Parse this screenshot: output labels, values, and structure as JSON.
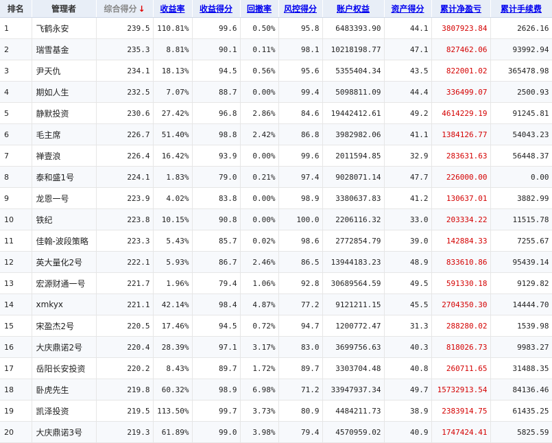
{
  "headers": {
    "rank": "排名",
    "manager": "管理者",
    "total_score": "综合得分",
    "sort_arrow": "↓",
    "return_rate": "收益率",
    "return_score": "收益得分",
    "drawdown": "回撤率",
    "risk_score": "风控得分",
    "equity": "账户权益",
    "asset_score": "资产得分",
    "cum_pnl": "累计净盈亏",
    "cum_fee": "累计手续费"
  },
  "rows": [
    {
      "rank": "1",
      "manager": "飞鹤永安",
      "total": "239.5",
      "ret": "110.81%",
      "retScore": "99.6",
      "dd": "0.50%",
      "risk": "95.8",
      "equity": "6483393.90",
      "asset": "44.1",
      "pnl": "3807923.84",
      "fee": "2626.16"
    },
    {
      "rank": "2",
      "manager": "瑞雪基金",
      "total": "235.3",
      "ret": "8.81%",
      "retScore": "90.1",
      "dd": "0.11%",
      "risk": "98.1",
      "equity": "10218198.77",
      "asset": "47.1",
      "pnl": "827462.06",
      "fee": "93992.94"
    },
    {
      "rank": "3",
      "manager": "尹天仇",
      "total": "234.1",
      "ret": "18.13%",
      "retScore": "94.5",
      "dd": "0.56%",
      "risk": "95.6",
      "equity": "5355404.34",
      "asset": "43.5",
      "pnl": "822001.02",
      "fee": "365478.98"
    },
    {
      "rank": "4",
      "manager": "期如人生",
      "total": "232.5",
      "ret": "7.07%",
      "retScore": "88.7",
      "dd": "0.00%",
      "risk": "99.4",
      "equity": "5098811.09",
      "asset": "44.4",
      "pnl": "336499.07",
      "fee": "2500.93"
    },
    {
      "rank": "5",
      "manager": "静默投资",
      "total": "230.6",
      "ret": "27.42%",
      "retScore": "96.8",
      "dd": "2.86%",
      "risk": "84.6",
      "equity": "19442412.61",
      "asset": "49.2",
      "pnl": "4614229.19",
      "fee": "91245.81"
    },
    {
      "rank": "6",
      "manager": "毛主席",
      "total": "226.7",
      "ret": "51.40%",
      "retScore": "98.8",
      "dd": "2.42%",
      "risk": "86.8",
      "equity": "3982982.06",
      "asset": "41.1",
      "pnl": "1384126.77",
      "fee": "54043.23"
    },
    {
      "rank": "7",
      "manager": "禅壹浪",
      "total": "226.4",
      "ret": "16.42%",
      "retScore": "93.9",
      "dd": "0.00%",
      "risk": "99.6",
      "equity": "2011594.85",
      "asset": "32.9",
      "pnl": "283631.63",
      "fee": "56448.37"
    },
    {
      "rank": "8",
      "manager": "泰和盛1号",
      "total": "224.1",
      "ret": "1.83%",
      "retScore": "79.0",
      "dd": "0.21%",
      "risk": "97.4",
      "equity": "9028071.14",
      "asset": "47.7",
      "pnl": "226000.00",
      "fee": "0.00"
    },
    {
      "rank": "9",
      "manager": "龙恩一号",
      "total": "223.9",
      "ret": "4.02%",
      "retScore": "83.8",
      "dd": "0.00%",
      "risk": "98.9",
      "equity": "3380637.83",
      "asset": "41.2",
      "pnl": "130637.01",
      "fee": "3882.99"
    },
    {
      "rank": "10",
      "manager": "铁纪",
      "total": "223.8",
      "ret": "10.15%",
      "retScore": "90.8",
      "dd": "0.00%",
      "risk": "100.0",
      "equity": "2206116.32",
      "asset": "33.0",
      "pnl": "203334.22",
      "fee": "11515.78"
    },
    {
      "rank": "11",
      "manager": "佳翰-波段策略",
      "total": "223.3",
      "ret": "5.43%",
      "retScore": "85.7",
      "dd": "0.02%",
      "risk": "98.6",
      "equity": "2772854.79",
      "asset": "39.0",
      "pnl": "142884.33",
      "fee": "7255.67"
    },
    {
      "rank": "12",
      "manager": "英大量化2号",
      "total": "222.1",
      "ret": "5.93%",
      "retScore": "86.7",
      "dd": "2.46%",
      "risk": "86.5",
      "equity": "13944183.23",
      "asset": "48.9",
      "pnl": "833610.86",
      "fee": "95439.14"
    },
    {
      "rank": "13",
      "manager": "宏源财通一号",
      "total": "221.7",
      "ret": "1.96%",
      "retScore": "79.4",
      "dd": "1.06%",
      "risk": "92.8",
      "equity": "30689564.59",
      "asset": "49.5",
      "pnl": "591330.18",
      "fee": "9129.82"
    },
    {
      "rank": "14",
      "manager": "xmkyx",
      "total": "221.1",
      "ret": "42.14%",
      "retScore": "98.4",
      "dd": "4.87%",
      "risk": "77.2",
      "equity": "9121211.15",
      "asset": "45.5",
      "pnl": "2704350.30",
      "fee": "14444.70"
    },
    {
      "rank": "15",
      "manager": "宋盈杰2号",
      "total": "220.5",
      "ret": "17.46%",
      "retScore": "94.5",
      "dd": "0.72%",
      "risk": "94.7",
      "equity": "1200772.47",
      "asset": "31.3",
      "pnl": "288280.02",
      "fee": "1539.98"
    },
    {
      "rank": "16",
      "manager": "大庆鼎诺2号",
      "total": "220.4",
      "ret": "28.39%",
      "retScore": "97.1",
      "dd": "3.17%",
      "risk": "83.0",
      "equity": "3699756.63",
      "asset": "40.3",
      "pnl": "818026.73",
      "fee": "9983.27"
    },
    {
      "rank": "17",
      "manager": "岳阳长安投资",
      "total": "220.2",
      "ret": "8.43%",
      "retScore": "89.7",
      "dd": "1.72%",
      "risk": "89.7",
      "equity": "3303704.48",
      "asset": "40.8",
      "pnl": "260711.65",
      "fee": "31488.35"
    },
    {
      "rank": "18",
      "manager": "卧虎先生",
      "total": "219.8",
      "ret": "60.32%",
      "retScore": "98.9",
      "dd": "6.98%",
      "risk": "71.2",
      "equity": "33947937.34",
      "asset": "49.7",
      "pnl": "15732913.54",
      "fee": "84136.46"
    },
    {
      "rank": "19",
      "manager": "凯泽投资",
      "total": "219.5",
      "ret": "113.50%",
      "retScore": "99.7",
      "dd": "3.73%",
      "risk": "80.9",
      "equity": "4484211.73",
      "asset": "38.9",
      "pnl": "2383914.75",
      "fee": "61435.25"
    },
    {
      "rank": "20",
      "manager": "大庆鼎诺3号",
      "total": "219.3",
      "ret": "61.89%",
      "retScore": "99.0",
      "dd": "3.98%",
      "risk": "79.4",
      "equity": "4570959.02",
      "asset": "40.9",
      "pnl": "1747424.41",
      "fee": "5825.59"
    }
  ]
}
